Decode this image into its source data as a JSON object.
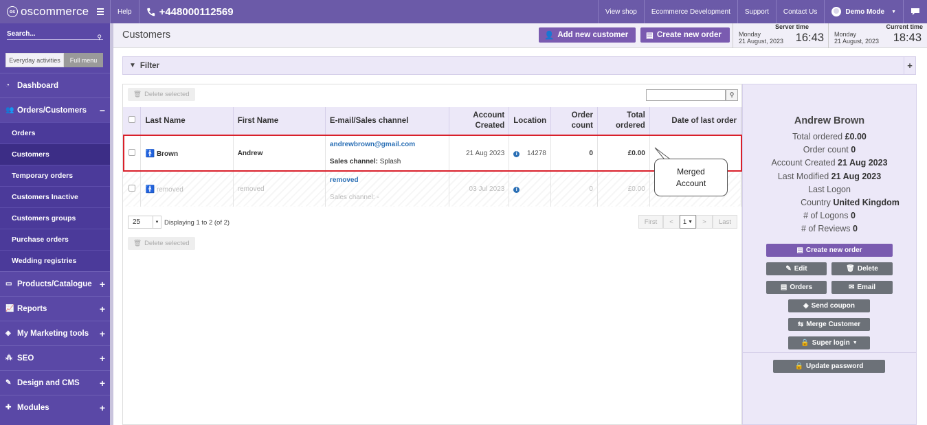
{
  "topbar": {
    "logo": "oscommerce",
    "help": "Help",
    "phone": "+448000112569",
    "links": [
      "View shop",
      "Ecommerce Development",
      "Support",
      "Contact Us"
    ],
    "user": "Demo Mode"
  },
  "sidebar": {
    "search_placeholder": "Search...",
    "modes": [
      "Everyday activities",
      "Full menu"
    ],
    "items": [
      {
        "label": "Dashboard",
        "icon": "dashboard-icon"
      },
      {
        "label": "Orders/Customers",
        "icon": "users-icon",
        "toggle": "−"
      },
      {
        "label": "Products/Catalogue",
        "icon": "folder-icon",
        "toggle": "+"
      },
      {
        "label": "Reports",
        "icon": "chart-icon",
        "toggle": "+"
      },
      {
        "label": "My Marketing tools",
        "icon": "tag-icon",
        "toggle": "+"
      },
      {
        "label": "SEO",
        "icon": "sitemap-icon",
        "toggle": "+"
      },
      {
        "label": "Design and CMS",
        "icon": "brush-icon",
        "toggle": "+"
      },
      {
        "label": "Modules",
        "icon": "puzzle-icon",
        "toggle": "+"
      }
    ],
    "subitems": [
      "Orders",
      "Customers",
      "Temporary orders",
      "Customers Inactive",
      "Customers groups",
      "Purchase orders",
      "Wedding registries"
    ]
  },
  "header": {
    "title": "Customers",
    "add_customer": "Add new customer",
    "create_order": "Create new order",
    "server_time": {
      "title": "Server time",
      "day": "Monday",
      "date": "21 August, 2023",
      "time": "16:43"
    },
    "current_time": {
      "title": "Current time",
      "day": "Monday",
      "date": "21 August, 2023",
      "time": "18:43"
    }
  },
  "filter": {
    "label": "Filter",
    "toggle": "+"
  },
  "table": {
    "delete_selected": "Delete selected",
    "columns": [
      "Last Name",
      "First Name",
      "E-mail/Sales channel",
      "Account Created",
      "Location",
      "Order count",
      "Total ordered",
      "Date of last order"
    ],
    "rows": [
      {
        "last": "Brown",
        "first": "Andrew",
        "email": "andrewbrown@gmail.com",
        "channel_label": "Sales channel:",
        "channel": "Splash",
        "created": "21 Aug 2023",
        "location": "14278",
        "orders": "0",
        "total": "£0.00",
        "last_order": ""
      },
      {
        "last": "removed",
        "first": "removed",
        "email": "removed",
        "channel_label": "Sales channel:",
        "channel": "-",
        "created": "03 Jul 2023",
        "location": "",
        "orders": "0",
        "total": "£0.00",
        "last_order": ""
      }
    ],
    "per_page": "25",
    "displaying": "Displaying 1 to 2 (of 2)",
    "pager": {
      "first": "First",
      "prev": "<",
      "page": "1",
      "next": ">",
      "last": "Last"
    }
  },
  "callout": {
    "line1": "Merged",
    "line2": "Account"
  },
  "details": {
    "name": "Andrew Brown",
    "lines": [
      {
        "label": "Total ordered",
        "value": "£0.00"
      },
      {
        "label": "Order count",
        "value": "0"
      },
      {
        "label": "Account Created",
        "value": "21 Aug 2023"
      },
      {
        "label": "Last Modified",
        "value": "21 Aug 2023"
      },
      {
        "label": "Last Logon",
        "value": ""
      },
      {
        "label": "Country",
        "value": "United Kingdom"
      },
      {
        "label": "# of Logons",
        "value": "0"
      },
      {
        "label": "# of Reviews",
        "value": "0"
      }
    ],
    "buttons": {
      "create_order": "Create new order",
      "edit": "Edit",
      "delete": "Delete",
      "orders": "Orders",
      "email": "Email",
      "send_coupon": "Send coupon",
      "merge": "Merge Customer",
      "super_login": "Super login",
      "update_password": "Update password"
    }
  },
  "colors": {
    "primary": "#6b5aa8",
    "sidebar": "#5a48a6",
    "accent_button": "#7a5bb0",
    "highlight": "#d9202a"
  }
}
